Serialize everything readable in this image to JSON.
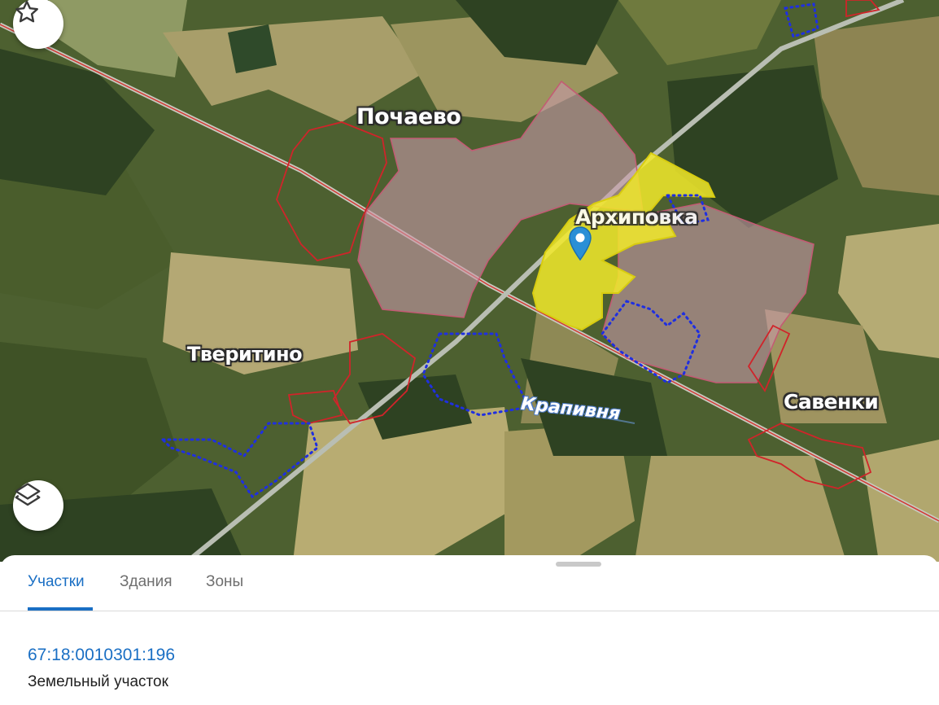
{
  "map": {
    "places": [
      {
        "id": "pochaevo",
        "name": "Почаево"
      },
      {
        "id": "arkhipovka",
        "name": "Архиповка"
      },
      {
        "id": "tveritino",
        "name": "Тверитино"
      },
      {
        "id": "savenki",
        "name": "Савенки"
      }
    ],
    "river": "Крапивня",
    "colors": {
      "selected_parcel": "#f2ea2a",
      "settlement_fill": "#c89aa8",
      "boundary_red": "#d0242a",
      "boundary_blue": "#1f2fe0",
      "marker": "#2a8fd6"
    },
    "icons": {
      "favorite": "star-outline-icon",
      "layers": "layers-icon",
      "marker": "map-pin-icon"
    }
  },
  "sheet": {
    "tabs": [
      {
        "label": "Участки",
        "active": true
      },
      {
        "label": "Здания",
        "active": false
      },
      {
        "label": "Зоны",
        "active": false
      }
    ],
    "parcel": {
      "cadastral_number": "67:18:0010301:196",
      "type": "Земельный участок"
    }
  }
}
